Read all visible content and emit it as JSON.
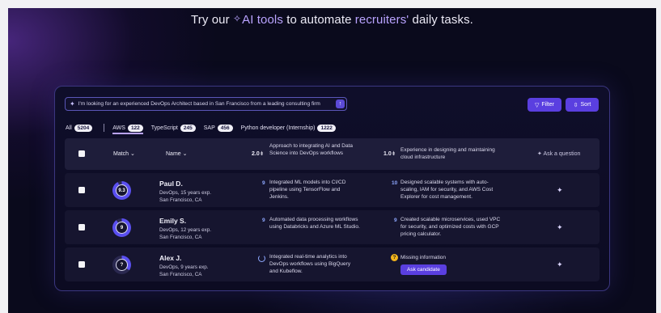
{
  "headline": {
    "pre": "Try our ",
    "spark": "✧",
    "ai": "AI tools",
    "mid": " to automate ",
    "rec": "recruiters'",
    "post": " daily tasks."
  },
  "search": {
    "query": "I'm looking for an experienced DevOps Architect based in San Francisco from a leading consulting firm"
  },
  "buttons": {
    "filter": "Filter",
    "sort": "Sort"
  },
  "tabs": [
    {
      "label": "All",
      "count": "5204"
    },
    {
      "label": "AWS",
      "count": "122"
    },
    {
      "label": "TypeScript",
      "count": "245"
    },
    {
      "label": "SAP",
      "count": "456"
    },
    {
      "label": "Python developer (Internship)",
      "count": "1222"
    }
  ],
  "header": {
    "match": "Match",
    "name": "Name",
    "col1_score": "2.0",
    "col1_text": "Approach to integrating AI and Data Science into DevOps workflows",
    "col2_score": "1.0",
    "col2_text": "Experience in designing and maintaining cloud infrastructure",
    "ask": "Ask a question"
  },
  "rows": [
    {
      "name": "Paul D.",
      "role": "DevOps, 15 years exp.",
      "location": "San Francisco, CA",
      "match": "9.3",
      "match_fraction": 0.93,
      "c1_score": "9",
      "c1_text": "Integrated ML models into CI/CD pipeline using TensorFlow and Jenkins.",
      "c2_score": "10",
      "c2_text": "Designed scalable systems with auto-scaling, IAM for security, and AWS Cost Explorer for cost management."
    },
    {
      "name": "Emily S.",
      "role": "DevOps, 12 years exp.",
      "location": "San Francisco, CA",
      "match": "9",
      "match_fraction": 0.9,
      "c1_score": "9",
      "c1_text": "Automated data processing workflows using Databricks and Azure ML Studio.",
      "c2_score": "9",
      "c2_text": "Created scalable microservices, used VPC for security, and optimized costs with GCP pricing calculator."
    },
    {
      "name": "Alex J.",
      "role": "DevOps, 9 years exp.",
      "location": "San Francisco, CA",
      "match": "?",
      "match_fraction": 0.35,
      "c1_text": "Integrated real-time analytics into DevOps workflows using BigQuery and Kubeflow.",
      "c2_missing": "Missing information",
      "c2_ask": "Ask candidate"
    }
  ],
  "colors": {
    "accent": "#5a3fe0",
    "highlight": "#b9a3ff",
    "score": "#8ea8ff",
    "warning": "#f3b51c"
  }
}
